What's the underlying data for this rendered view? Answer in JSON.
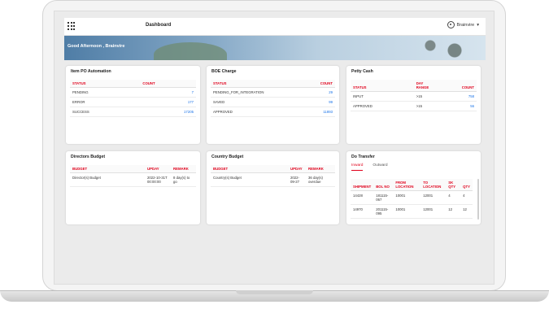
{
  "header": {
    "title": "Dashboard",
    "user": "Brainvire"
  },
  "hero": {
    "greeting": "Good Afternoon , Brainvire"
  },
  "item_po": {
    "title": "Item PO Automation",
    "columns": [
      "STATUS",
      "COUNT"
    ],
    "rows": [
      [
        "PENDING",
        "7"
      ],
      [
        "ERROR",
        "177"
      ],
      [
        "SUCCESS",
        "17205"
      ]
    ]
  },
  "boe": {
    "title": "BOE Charge",
    "columns": [
      "STATUS",
      "COUNT"
    ],
    "rows": [
      [
        "PENDING_FOR_INTEGRATION",
        "29"
      ],
      [
        "SAVED",
        "99"
      ],
      [
        "APPROVED",
        "11893"
      ]
    ]
  },
  "petty": {
    "title": "Petty Cash",
    "columns": [
      "STATUS",
      "DAY RANGE",
      "COUNT"
    ],
    "rows": [
      [
        "INPUT",
        ">15",
        "758"
      ],
      [
        "APPROVED",
        ">15",
        "56"
      ]
    ]
  },
  "directors": {
    "title": "Directors Budget",
    "columns": [
      "BUDGET",
      "UPDAY",
      "REMARK"
    ],
    "rows": [
      [
        "Director(s) Budget",
        "2022-10-31T00:00:00",
        "8 day(s) to go"
      ]
    ]
  },
  "country": {
    "title": "Country Budget",
    "columns": [
      "BUDGET",
      "UPDAY",
      "REMARK"
    ],
    "rows": [
      [
        "Country(s) Budget",
        "2022-09-27",
        "36 day(s) overdue"
      ]
    ]
  },
  "do_transfer": {
    "title": "Do Transfer",
    "tabs": [
      "Inward",
      "Outward"
    ],
    "columns": [
      "SHIPMENT",
      "BOL NO",
      "FROM LOCATION",
      "TO LOCATION",
      "SK QTY",
      "QTY"
    ],
    "rows": [
      [
        "14428",
        "181115-067",
        "10001",
        "12001",
        "4",
        "4"
      ],
      [
        "14970",
        "201115-095",
        "10001",
        "12001",
        "12",
        "12"
      ]
    ]
  }
}
